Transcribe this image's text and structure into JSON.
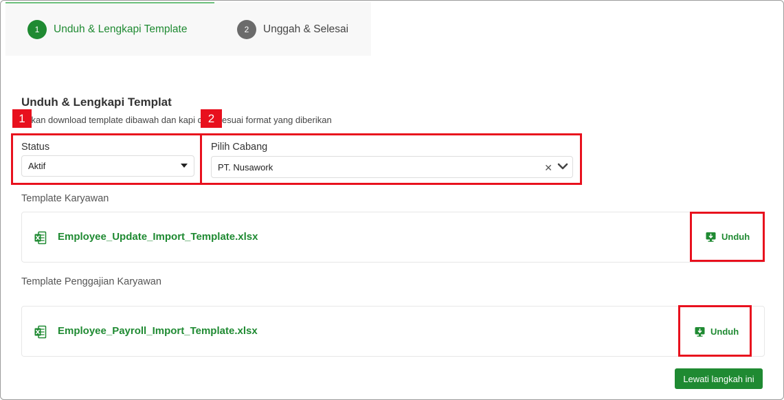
{
  "stepper": {
    "steps": [
      {
        "number": "1",
        "label": "Unduh & Lengkapi Template",
        "state": "active"
      },
      {
        "number": "2",
        "label": "Unggah & Selesai",
        "state": "inactive"
      }
    ]
  },
  "section": {
    "title": "Unduh & Lengkapi Templat",
    "description": "ahkan download template dibawah dan  kapi data sesuai format yang diberikan"
  },
  "filters": {
    "status": {
      "label": "Status",
      "value": "Aktif"
    },
    "cabang": {
      "label": "Pilih Cabang",
      "value": "PT. Nusawork"
    }
  },
  "templates": [
    {
      "group_label": "Template Karyawan",
      "file_name": "Employee_Update_Import_Template.xlsx",
      "download_label": "Unduh"
    },
    {
      "group_label": "Template Penggajian Karyawan",
      "file_name": "Employee_Payroll_Import_Template.xlsx",
      "download_label": "Unduh"
    }
  ],
  "actions": {
    "skip_label": "Lewati langkah ini"
  },
  "annotations": {
    "badge1": "1",
    "badge2": "2"
  },
  "colors": {
    "primary": "#1f8a32",
    "annotation": "#e8101d",
    "inactive_step": "#6b6b6b"
  }
}
